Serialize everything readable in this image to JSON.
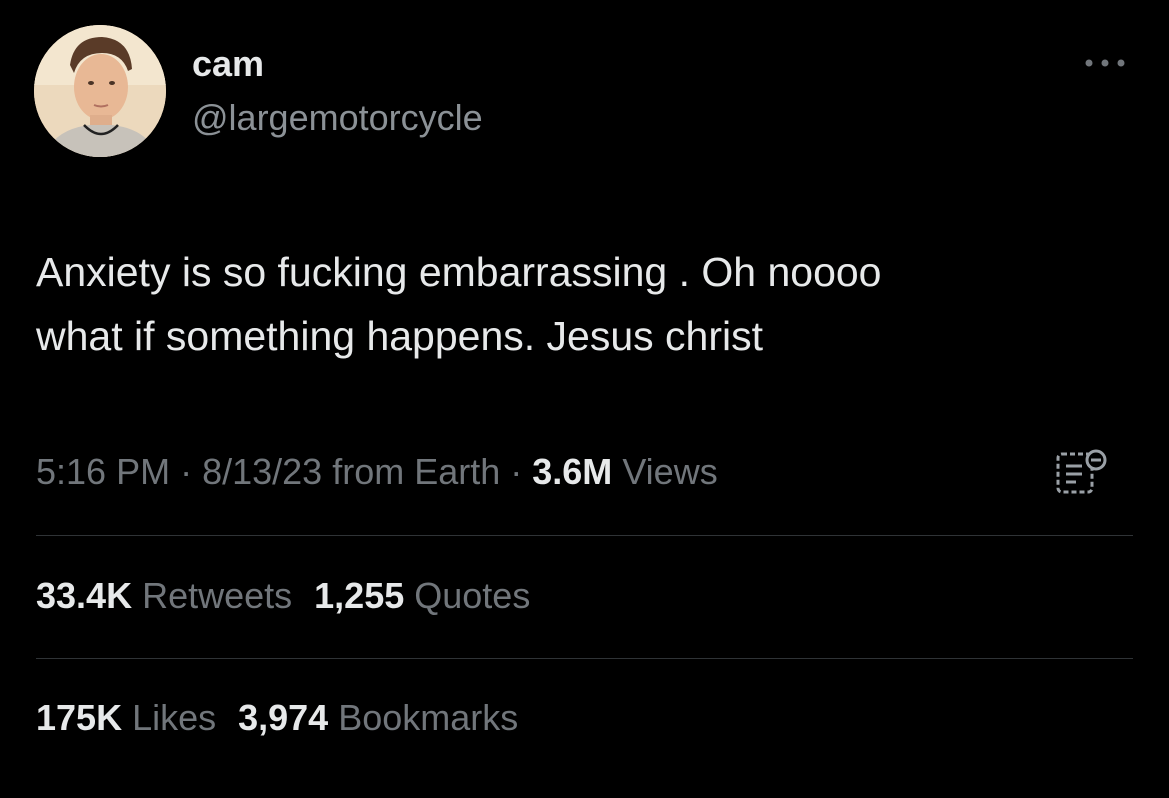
{
  "user": {
    "display_name": "cam",
    "handle": "@largemotorcycle"
  },
  "tweet": {
    "text": "Anxiety is so fucking embarrassing . Oh noooo\nwhat if something happens. Jesus christ"
  },
  "meta": {
    "time": "5:16 PM",
    "sep1": " · ",
    "date": "8/13/23",
    "source": " from Earth",
    "sep2": " · ",
    "views_count": "3.6M",
    "views_label": " Views"
  },
  "stats": {
    "retweets_count": "33.4K",
    "retweets_label": " Retweets",
    "quotes_count": "1,255",
    "quotes_label": " Quotes",
    "likes_count": "175K",
    "likes_label": " Likes",
    "bookmarks_count": "3,974",
    "bookmarks_label": " Bookmarks"
  },
  "icons": {
    "more": "more-icon",
    "analytics": "analytics-icon"
  },
  "colors": {
    "background": "#000000",
    "primary_text": "#e7e9ea",
    "secondary_text": "#71767b",
    "divider": "#2f3336"
  }
}
